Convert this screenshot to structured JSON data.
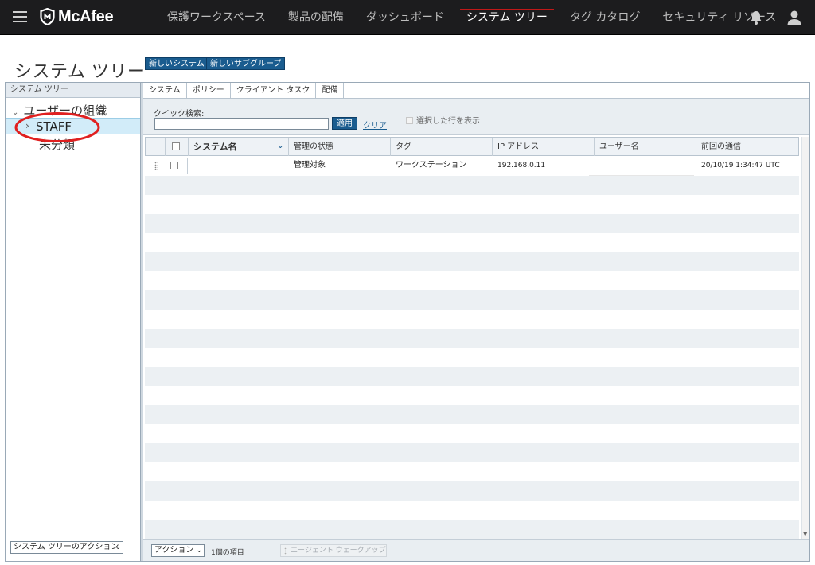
{
  "nav": {
    "logo": "McAfee",
    "items": [
      "保護ワークスペース",
      "製品の配備",
      "ダッシュボード",
      "システム ツリー",
      "タグ カタログ",
      "セキュリティ リソース"
    ],
    "active_index": 3,
    "icons": [
      "menu-icon",
      "bell-icon",
      "user-icon"
    ]
  },
  "page": {
    "title": "システム ツリー",
    "new_system_button": "新しいシステム",
    "new_subgroup_button": "新しいサブグループ"
  },
  "tree": {
    "header": "システム ツリー",
    "root": "ユーザーの組織",
    "selected": "STAFF",
    "unclassified": "未分類",
    "actions_select": "システム ツリーのアクション"
  },
  "tabs": [
    "システム",
    "ポリシー",
    "クライアント タスク",
    "配備"
  ],
  "toolbar": {
    "quick_search_label": "クイック検索:",
    "quick_search_value": "",
    "apply_button": "適用",
    "clear_link": "クリア",
    "show_selected": "選択した行を表示"
  },
  "grid": {
    "columns": [
      "システム名",
      "管理の状態",
      "タグ",
      "IP アドレス",
      "ユーザー名",
      "前回の通信"
    ],
    "rows": [
      {
        "system_name": "",
        "managed_state": "管理対象",
        "tag": "ワークステーション",
        "ip_address": "192.168.0.11",
        "user_name": "",
        "last_communication": "20/10/19 1:34:47 UTC"
      }
    ]
  },
  "footer": {
    "actions_select": "アクション",
    "item_count": "1個の項目",
    "wake_up_button": "エージェント ウェークアップ"
  },
  "colors": {
    "nav_bg": "#1c1c1e",
    "brand_button": "#1a5c8f",
    "selected_row": "#d2ecf9",
    "callout": "#e02020"
  }
}
